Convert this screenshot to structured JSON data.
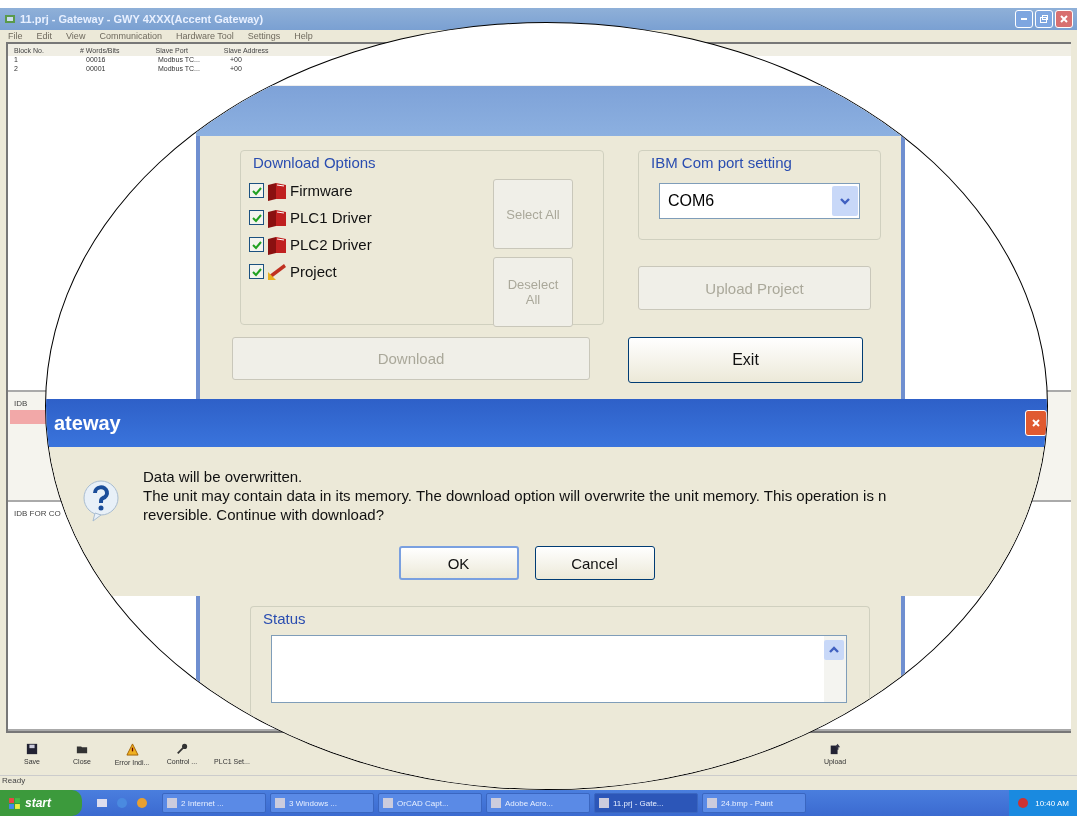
{
  "window": {
    "title": "11.prj - Gateway - GWY 4XXX(Accent Gateway)"
  },
  "menu": [
    "File",
    "Edit",
    "View",
    "Communication",
    "Hardware Tool",
    "Settings",
    "Help"
  ],
  "table": {
    "columns": [
      "Block No.",
      "# Words/Bits",
      "Slave Port",
      "Slave Address"
    ],
    "rows": [
      [
        "1",
        "00016",
        "Modbus TC...",
        "+00"
      ],
      [
        "2",
        "00001",
        "Modbus TC...",
        "+00"
      ]
    ]
  },
  "panels": [
    "IDB",
    "IDB FOR CO"
  ],
  "toolbar": [
    {
      "label": "Save",
      "kind": "save"
    },
    {
      "label": "Close",
      "kind": "folder"
    },
    {
      "label": "Error Indi...",
      "kind": "warning"
    },
    {
      "label": "Control ...",
      "kind": "key"
    },
    {
      "label": "PLC1 Set...",
      "kind": "none"
    },
    {
      "label": "Upload",
      "kind": "upload"
    }
  ],
  "status_bar": "Ready",
  "taskbar": {
    "start": "start",
    "items": [
      {
        "label": "2 Internet ...",
        "selected": false
      },
      {
        "label": "3 Windows ...",
        "selected": false
      },
      {
        "label": "OrCAD Capt...",
        "selected": false
      },
      {
        "label": "Adobe Acro...",
        "selected": false
      },
      {
        "label": "11.prj - Gate...",
        "selected": true
      },
      {
        "label": "24.bmp - Paint",
        "selected": false
      }
    ],
    "clock": "10:40 AM"
  },
  "dialog": {
    "download_options": {
      "title": "Download Options",
      "items": [
        {
          "label": "Firmware",
          "checked": true,
          "kind": "book"
        },
        {
          "label": "PLC1 Driver",
          "checked": true,
          "kind": "book"
        },
        {
          "label": "PLC2 Driver",
          "checked": true,
          "kind": "book"
        },
        {
          "label": "Project",
          "checked": true,
          "kind": "project"
        }
      ],
      "select_all": {
        "label": "Select All",
        "disabled": true
      },
      "deselect_all": {
        "label": "Deselect All",
        "disabled": true
      }
    },
    "com_port": {
      "title": "IBM Com port setting",
      "value": "COM6"
    },
    "upload_project": {
      "label": "Upload Project",
      "disabled": true
    },
    "download": {
      "label": "Download",
      "disabled": true
    },
    "exit": {
      "label": "Exit",
      "disabled": false
    },
    "status": {
      "title": "Status"
    }
  },
  "message_box": {
    "title": "ateway",
    "lines": [
      "Data will be overwritten.",
      "The unit may contain data in its memory. The download option will overwrite the unit memory. This operation is n",
      "reversible. Continue with download?"
    ],
    "buttons": [
      "OK",
      "Cancel"
    ]
  }
}
